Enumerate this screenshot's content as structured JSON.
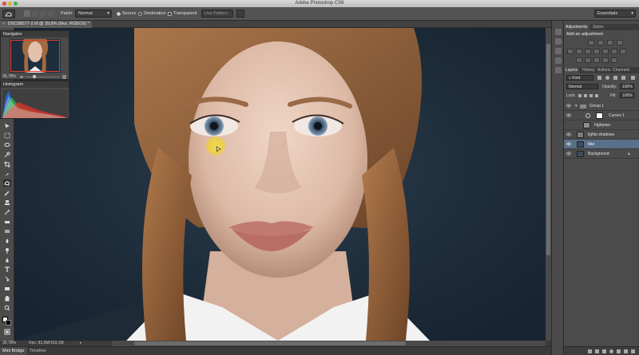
{
  "app": {
    "title": "Adobe Photoshop CS6"
  },
  "options_bar": {
    "patch_label": "Patch:",
    "patch_mode": "Normal",
    "source_label": "Source",
    "destination_label": "Destination",
    "transparent_label": "Transparent",
    "use_pattern_label": "Use Pattern",
    "workspace": "Essentials"
  },
  "document": {
    "tab_title": "DSC08577-2.tif @ 39,8% (blur, RGB/16) *",
    "zoom": "39,78%",
    "doc_size": "Doc: 81,0M/153,1M"
  },
  "panels": {
    "navigator_title": "Navigator",
    "navigator_zoom": "39,78%",
    "histogram_title": "Histogram",
    "adjustments_tab": "Adjustments",
    "styles_tab": "Styles",
    "add_adjustment": "Add an adjustment",
    "layers_tab": "Layers",
    "history_tab": "History",
    "actions_tab": "Actions",
    "channels_tab": "Channels",
    "kind_label": "Kind",
    "blend_mode": "Normal",
    "opacity_label": "Opacity:",
    "opacity_value": "100%",
    "lock_label": "Lock:",
    "fill_label": "Fill:",
    "fill_value": "100%"
  },
  "layers": [
    {
      "name": "Group 1",
      "type": "group"
    },
    {
      "name": "Curves 1",
      "type": "adjustment"
    },
    {
      "name": "highpass",
      "type": "layer"
    },
    {
      "name": "lights-shadows",
      "type": "layer"
    },
    {
      "name": "blur",
      "type": "layer",
      "selected": true
    },
    {
      "name": "Background",
      "type": "background"
    }
  ],
  "bottom_tabs": {
    "mini_bridge": "Mini Bridge",
    "timeline": "Timeline"
  },
  "colors": {
    "ui_dark": "#3a3a3a",
    "ui_panel": "#4b4b4b",
    "selected_layer": "#5a6f88",
    "nav_view_box": "#e23b2e",
    "cursor_spot": "#f0d232"
  }
}
